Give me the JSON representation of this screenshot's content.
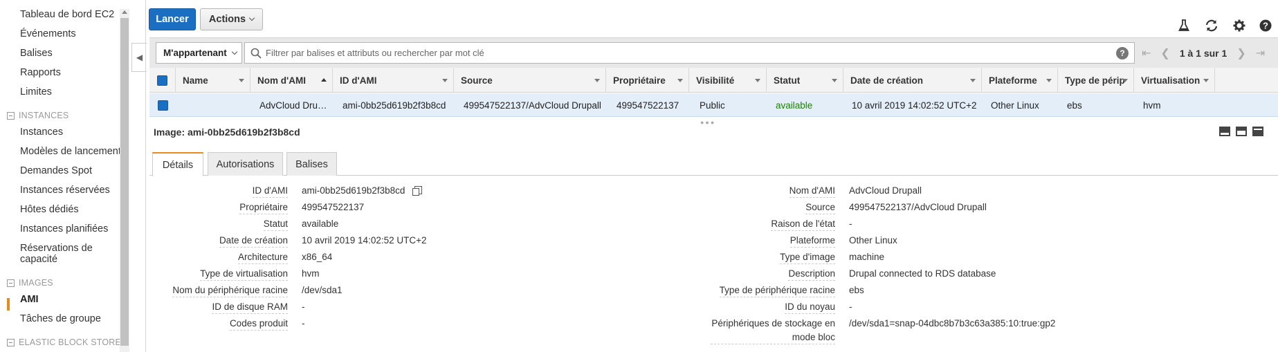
{
  "sidebar": {
    "items": [
      {
        "label": "Tableau de bord EC2"
      },
      {
        "label": "Événements"
      },
      {
        "label": "Balises"
      },
      {
        "label": "Rapports"
      },
      {
        "label": "Limites"
      },
      {
        "section": "INSTANCES"
      },
      {
        "label": "Instances"
      },
      {
        "label": "Modèles de lancement"
      },
      {
        "label": "Demandes Spot"
      },
      {
        "label": "Instances réservées"
      },
      {
        "label": "Hôtes dédiés"
      },
      {
        "label": "Instances planifiées"
      },
      {
        "label": "Réservations de"
      },
      {
        "label": "capacité"
      },
      {
        "section": "IMAGES"
      },
      {
        "label": "AMI"
      },
      {
        "label": "Tâches de groupe"
      },
      {
        "section": "ELASTIC BLOCK STORE"
      }
    ],
    "active": "AMI"
  },
  "toolbar": {
    "launch": "Lancer",
    "actions": "Actions"
  },
  "icons": [
    "flask-icon",
    "refresh-icon",
    "gear-icon",
    "help-icon"
  ],
  "filter": {
    "owner": "M'appartenant",
    "placeholder": "Filtrer par balises et attributs ou rechercher par mot clé",
    "pager": "1 à 1 sur 1"
  },
  "table": {
    "columns": [
      "Name",
      "Nom d'AMI",
      "ID d'AMI",
      "Source",
      "Propriétaire",
      "Visibilité",
      "Statut",
      "Date de création",
      "Plateforme",
      "Type de périp",
      "Virtualisation"
    ],
    "row": {
      "name": "",
      "ami_name": "AdvCloud Dru…",
      "ami_id": "ami-0bb25d619b2f3b8cd",
      "source": "499547522137/AdvCloud Drupall",
      "owner": "499547522137",
      "visibility": "Public",
      "status": "available",
      "created": "10 avril 2019 14:02:52 UTC+2",
      "platform": "Other Linux",
      "device_type": "ebs",
      "virtualization": "hvm"
    }
  },
  "detail": {
    "title": "Image: ami-0bb25d619b2f3b8cd",
    "tabs": [
      "Détails",
      "Autorisations",
      "Balises"
    ],
    "left": [
      {
        "key": "ID d'AMI",
        "value": "ami-0bb25d619b2f3b8cd"
      },
      {
        "key": "Propriétaire",
        "value": "499547522137"
      },
      {
        "key": "Statut",
        "value": "available"
      },
      {
        "key": "Date de création",
        "value": "10 avril 2019 14:02:52 UTC+2"
      },
      {
        "key": "Architecture",
        "value": "x86_64"
      },
      {
        "key": "Type de virtualisation",
        "value": "hvm"
      },
      {
        "key": "Nom du périphérique racine",
        "value": "/dev/sda1"
      },
      {
        "key": "ID de disque RAM",
        "value": "-"
      },
      {
        "key": "Codes produit",
        "value": "-"
      }
    ],
    "right": [
      {
        "key": "Nom d'AMI",
        "value": "AdvCloud Drupall"
      },
      {
        "key": "Source",
        "value": "499547522137/AdvCloud Drupall"
      },
      {
        "key": "Raison de l'état",
        "value": "-"
      },
      {
        "key": "Plateforme",
        "value": "Other Linux"
      },
      {
        "key": "Type d'image",
        "value": "machine"
      },
      {
        "key": "Description",
        "value": "Drupal connected to RDS database"
      },
      {
        "key": "Type de périphérique racine",
        "value": "ebs"
      },
      {
        "key": "ID du noyau",
        "value": "-"
      },
      {
        "key": "Périphériques de stockage en",
        "value": "/dev/sda1=snap-04dbc8b7b3c63a385:10:true:gp2"
      },
      {
        "key": "mode bloc",
        "value": ""
      }
    ]
  },
  "colors": {
    "primary": "#1a6fc2",
    "accent": "#e88b1d",
    "status_available": "#1d8102",
    "selected_row": "#e3eef9"
  }
}
